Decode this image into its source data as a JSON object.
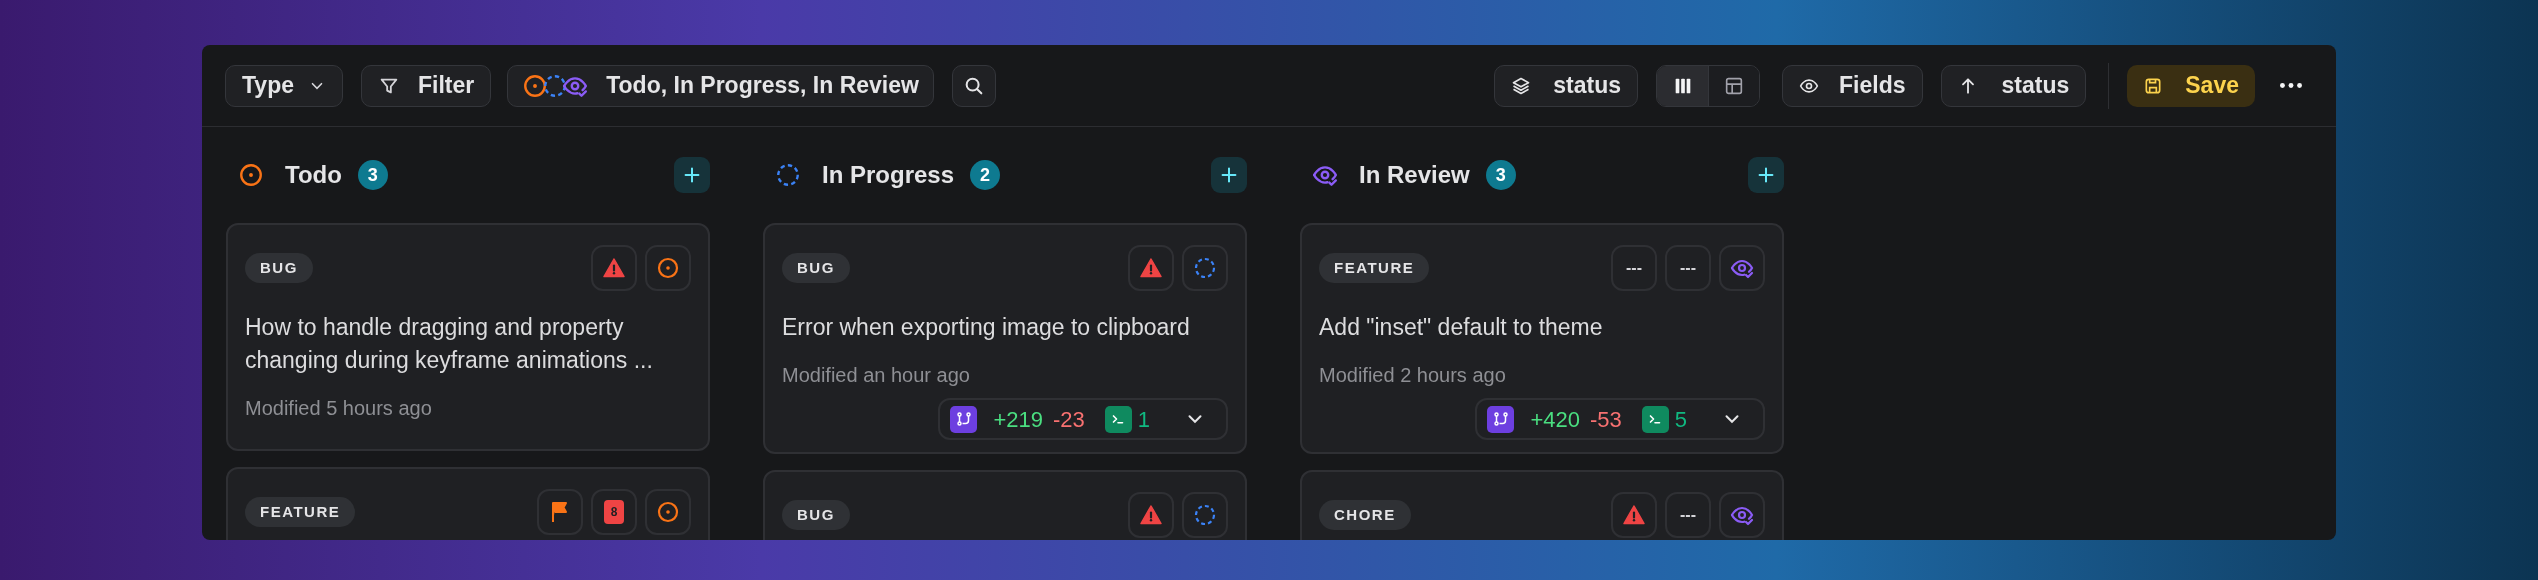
{
  "toolbar": {
    "type_button": {
      "label": "Type"
    },
    "filter_button": {
      "label": "Filter"
    },
    "status_filter": {
      "icons": [
        {
          "kind": "todo"
        },
        {
          "kind": "in_progress"
        },
        {
          "kind": "in_review"
        }
      ],
      "label": "Todo, In Progress, In Review"
    },
    "group_button": {
      "label": "status"
    },
    "view_toggle": [
      {
        "kind": "board",
        "selected": true
      },
      {
        "kind": "table",
        "selected": false
      }
    ],
    "fields_button": {
      "label": "Fields"
    },
    "sort_button": {
      "label": "status"
    },
    "save_button": {
      "label": "Save"
    }
  },
  "columns": [
    {
      "kind": "todo",
      "title": "Todo",
      "count": "3",
      "cards": [
        {
          "tag": "BUG",
          "properties": [
            {
              "kind": "urgent"
            },
            {
              "kind": "status"
            }
          ],
          "title": "How to handle dragging and property changing during keyframe animations ...",
          "modified": "Modified 5 hours ago"
        },
        {
          "tag": "FEATURE",
          "properties": [
            {
              "kind": "flag"
            },
            {
              "kind": "estimate",
              "text": "8"
            },
            {
              "kind": "status"
            }
          ]
        }
      ]
    },
    {
      "kind": "in_progress",
      "title": "In Progress",
      "count": "2",
      "cards": [
        {
          "tag": "BUG",
          "properties": [
            {
              "kind": "urgent"
            },
            {
              "kind": "status"
            }
          ],
          "title": "Error when exporting image to clipboard",
          "modified": "Modified an hour ago",
          "pr": {
            "additions": "+219",
            "deletions": "-23",
            "checks": "1"
          }
        },
        {
          "tag": "BUG",
          "properties": [
            {
              "kind": "urgent"
            },
            {
              "kind": "status"
            }
          ]
        }
      ]
    },
    {
      "kind": "in_review",
      "title": "In Review",
      "count": "3",
      "cards": [
        {
          "tag": "FEATURE",
          "properties": [
            {
              "kind": "empty",
              "text": "---"
            },
            {
              "kind": "empty",
              "text": "---"
            },
            {
              "kind": "status"
            }
          ],
          "title": "Add \"inset\" default to theme",
          "modified": "Modified 2 hours ago",
          "pr": {
            "additions": "+420",
            "deletions": "-53",
            "checks": "5"
          }
        },
        {
          "tag": "CHORE",
          "properties": [
            {
              "kind": "urgent"
            },
            {
              "kind": "empty",
              "text": "---"
            },
            {
              "kind": "status"
            }
          ]
        }
      ]
    }
  ]
}
